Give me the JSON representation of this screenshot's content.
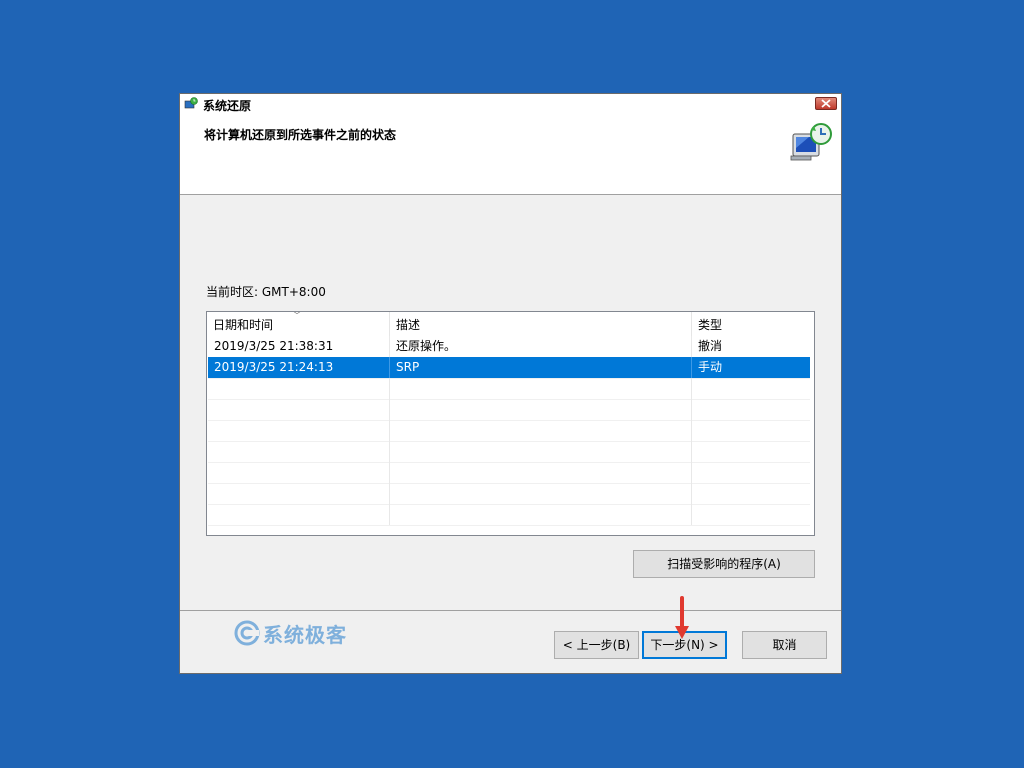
{
  "window": {
    "title": "系统还原",
    "close_icon": "close-icon",
    "app_icon": "system-restore-icon"
  },
  "header": {
    "title": "将计算机还原到所选事件之前的状态",
    "icon": "computer-restore-icon"
  },
  "timezone_label": "当前时区: GMT+8:00",
  "table": {
    "columns": [
      "日期和时间",
      "描述",
      "类型"
    ],
    "sorted_column": "日期和时间",
    "rows": [
      {
        "datetime": "2019/3/25 21:38:31",
        "description": "还原操作。",
        "type": "撤消",
        "selected": false
      },
      {
        "datetime": "2019/3/25 21:24:13",
        "description": "SRP",
        "type": "手动",
        "selected": true
      }
    ]
  },
  "buttons": {
    "scan": "扫描受影响的程序(A)",
    "back": "< 上一步(B)",
    "next": "下一步(N) >",
    "cancel": "取消"
  },
  "watermark": "系统极客",
  "colors": {
    "desktop": "#1f64b5",
    "selection": "#0078d7",
    "arrow": "#e0392f"
  }
}
